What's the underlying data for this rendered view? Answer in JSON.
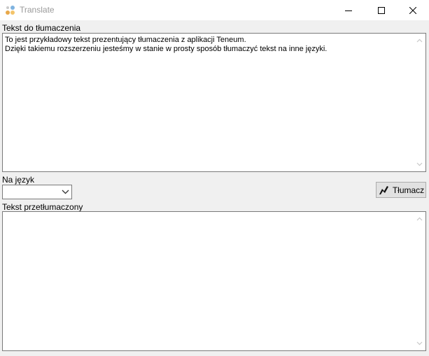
{
  "window": {
    "title": "Translate",
    "controls": {
      "minimize_icon": "minimize-icon",
      "maximize_icon": "maximize-icon",
      "close_icon": "close-icon"
    }
  },
  "source": {
    "label": "Tekst do tłumaczenia",
    "text": "To jest przykładowy tekst prezentujący tłumaczenia z aplikacji Teneum.\nDzięki takiemu rozszerzeniu jesteśmy w stanie w prosty sposób tłumaczyć tekst na inne języki."
  },
  "language": {
    "label": "Na język",
    "selected": ""
  },
  "translate_button": {
    "label": "Tłumacz",
    "icon": "lightning-icon"
  },
  "result": {
    "label": "Tekst przetłumaczony",
    "text": ""
  },
  "colors": {
    "window_bg": "#f0f0f0",
    "titlebar_bg": "#ffffff",
    "title_text": "#9a9a9a",
    "field_border": "#7a7a7a",
    "button_bg": "#e1e1e1",
    "button_border": "#adadad"
  }
}
